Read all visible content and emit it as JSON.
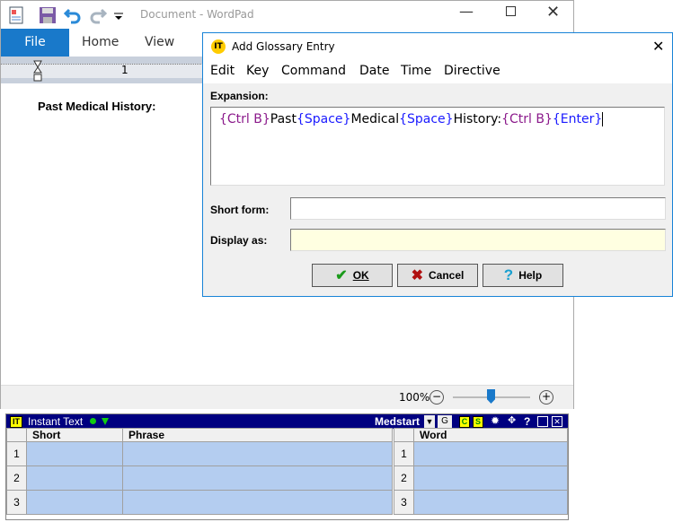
{
  "wordpad": {
    "title": "Document - WordPad",
    "tabs": [
      "File",
      "Home",
      "View"
    ],
    "ruler_mark": "1",
    "document_text": "Past Medical History:",
    "zoom": "100%",
    "zoom_level_percent": 100
  },
  "dialog": {
    "title": "Add Glossary Entry",
    "menu": [
      "Edit",
      "Key",
      "Command",
      "Date",
      "Time",
      "Directive"
    ],
    "expansion_label": "Expansion:",
    "expansion_tokens": [
      {
        "text": "{Ctrl B}",
        "kind": "tag"
      },
      {
        "text": "Past",
        "kind": "text"
      },
      {
        "text": "{Space}",
        "kind": "tag2"
      },
      {
        "text": "Medical",
        "kind": "text"
      },
      {
        "text": "{Space}",
        "kind": "tag2"
      },
      {
        "text": "History:",
        "kind": "text"
      },
      {
        "text": "{Ctrl B}",
        "kind": "tag"
      },
      {
        "text": "{Enter}",
        "kind": "tag2"
      }
    ],
    "short_form_label": "Short form:",
    "short_form_value": "",
    "display_as_label": "Display as:",
    "display_as_value": "",
    "ok": "OK",
    "cancel": "Cancel",
    "help": "Help",
    "colors": {
      "tag": "#8b1a8b",
      "tag2": "#1a1aff",
      "display_bg": "#ffffe1"
    }
  },
  "instant_text": {
    "title": "Instant Text",
    "logo": "IT",
    "glossary": "Medstart",
    "g_label": "G",
    "c_label": "C",
    "s_label": "S",
    "help_label": "?",
    "left_headers": [
      "Short",
      "Phrase"
    ],
    "right_headers": [
      "Word"
    ],
    "rows": [
      "1",
      "2",
      "3"
    ]
  }
}
